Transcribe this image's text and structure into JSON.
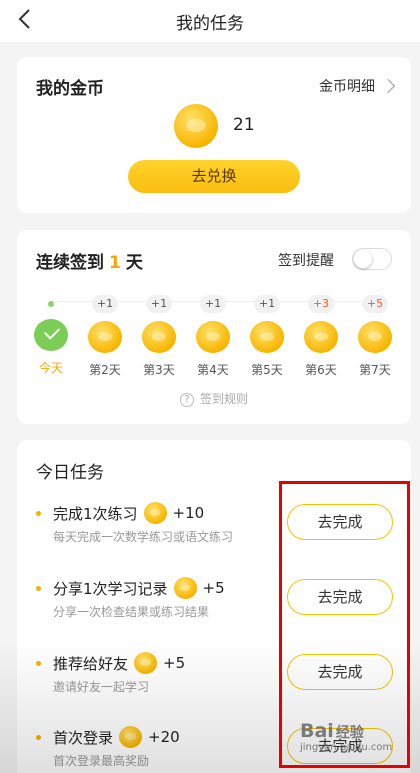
{
  "nav": {
    "title": "我的任务",
    "back_icon": "back-arrow-icon"
  },
  "coins": {
    "title": "我的金币",
    "detail_link": "金币明细",
    "amount": "21",
    "exchange_button": "去兑换"
  },
  "checkin": {
    "title_prefix": "连续签到",
    "days": "1",
    "title_suffix": "天",
    "reminder_label": "签到提醒",
    "reminder_on": false,
    "schedule": [
      {
        "bonus": "",
        "label": "今天",
        "done": true
      },
      {
        "bonus": "+1",
        "label": "第2天",
        "done": false
      },
      {
        "bonus": "+1",
        "label": "第3天",
        "done": false
      },
      {
        "bonus": "+1",
        "label": "第4天",
        "done": false
      },
      {
        "bonus": "+1",
        "label": "第5天",
        "done": false
      },
      {
        "bonus": "+3",
        "label": "第6天",
        "done": false
      },
      {
        "bonus": "+5",
        "label": "第7天",
        "done": false
      }
    ],
    "rules_label": "签到规则"
  },
  "tasks": {
    "title": "今日任务",
    "items": [
      {
        "name": "完成1次练习",
        "reward": "+10",
        "desc": "每天完成一次数学练习或语文练习",
        "button": "去完成"
      },
      {
        "name": "分享1次学习记录",
        "reward": "+5",
        "desc": "分享一次检查结果或练习结果",
        "button": "去完成"
      },
      {
        "name": "推荐给好友",
        "reward": "+5",
        "desc": "邀请好友一起学习",
        "button": "去完成"
      },
      {
        "name": "首次登录",
        "reward": "+20",
        "desc": "首次登录最高奖励",
        "button": "去完成"
      }
    ]
  },
  "watermark": {
    "brand": "Bai",
    "brand_suffix": "经验",
    "url": "jingyan.baidu.com"
  },
  "colors": {
    "accent": "#f5a800",
    "highlight_box": "#e80000",
    "checked": "#7ccd55"
  }
}
